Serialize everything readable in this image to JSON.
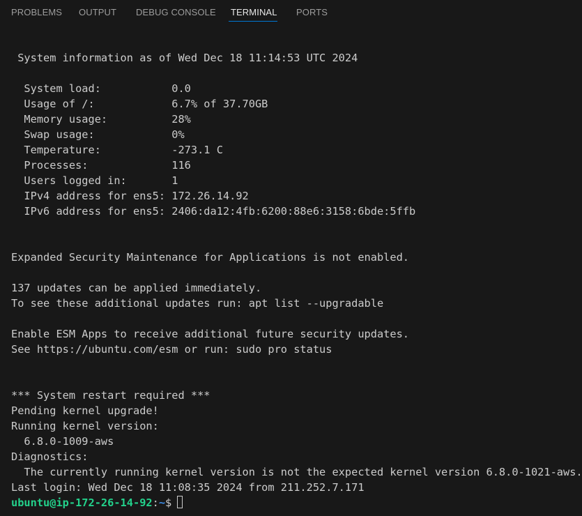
{
  "panel_tabs": [
    {
      "label": "PROBLEMS"
    },
    {
      "label": "OUTPUT"
    },
    {
      "label": "DEBUG CONSOLE"
    },
    {
      "label": "TERMINAL",
      "active": true
    },
    {
      "label": "PORTS"
    }
  ],
  "terminal": {
    "lines": [
      " System information as of Wed Dec 18 11:14:53 UTC 2024",
      "  System load:           0.0",
      "  Usage of /:            6.7% of 37.70GB",
      "  Memory usage:          28%",
      "  Swap usage:            0%",
      "  Temperature:           -273.1 C",
      "  Processes:             116",
      "  Users logged in:       1",
      "  IPv4 address for ens5: 172.26.14.92",
      "  IPv6 address for ens5: 2406:da12:4fb:6200:88e6:3158:6bde:5ffb",
      "Expanded Security Maintenance for Applications is not enabled.",
      "137 updates can be applied immediately.",
      "To see these additional updates run: apt list --upgradable",
      "Enable ESM Apps to receive additional future security updates.",
      "See https://ubuntu.com/esm or run: sudo pro status",
      "*** System restart required ***",
      "Pending kernel upgrade!",
      "Running kernel version:",
      "  6.8.0-1009-aws",
      "Diagnostics:",
      "  The currently running kernel version is not the expected kernel version 6.8.0-1021-aws.",
      "Last login: Wed Dec 18 11:08:35 2024 from 211.252.7.171"
    ],
    "prompt": {
      "user_host": "ubuntu@ip-172-26-14-92",
      "separator": ":",
      "path": "~",
      "symbol": "$"
    }
  },
  "colors": {
    "background": "#181818",
    "text": "#cccccc",
    "prompt_user": "#23d18b",
    "prompt_path": "#3b8eea",
    "active_tab_underline": "#0078d4"
  }
}
